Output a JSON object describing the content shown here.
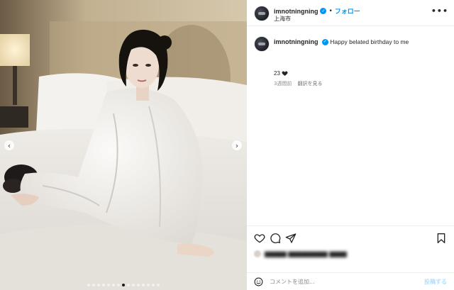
{
  "post": {
    "username": "imnotningning",
    "verified_glyph": "✓",
    "follow_separator": "•",
    "follow_label": "フォロー",
    "location": "上海市",
    "more_label": "•••"
  },
  "caption": {
    "username": "imnotningning",
    "text": "Happy belated birthday to me",
    "count": "23",
    "count_icon": "heart-icon",
    "age": "3週間前",
    "see_translation": "翻訳を見る"
  },
  "media": {
    "prev_glyph": "‹",
    "next_glyph": "›",
    "slide_count": 15,
    "active_slide": 7
  },
  "actions": {
    "like_icon": "heart-icon",
    "comment_icon": "comment-icon",
    "share_icon": "share-icon",
    "save_icon": "bookmark-icon"
  },
  "comment_box": {
    "placeholder": "コメントを追加...",
    "post_label": "投稿する",
    "emoji_icon": "emoji-icon"
  },
  "colors": {
    "accent": "#0095f6",
    "post_disabled": "#b2dffc",
    "text": "#262626",
    "muted": "#8e8e8e"
  }
}
